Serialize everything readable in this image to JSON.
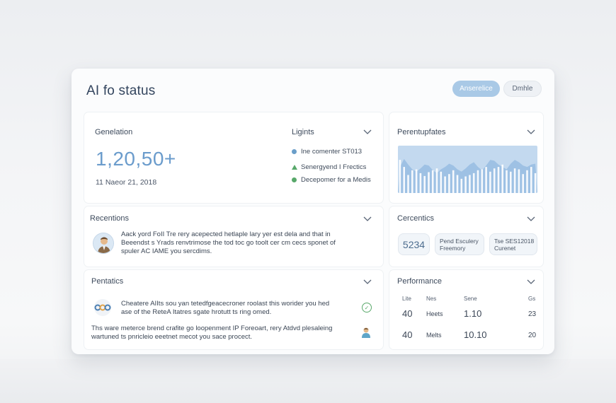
{
  "header": {
    "title": "AI fo status",
    "primary_button": "Anserelice",
    "secondary_button": "Dmhle"
  },
  "panel_generation": {
    "title": "Genelation",
    "value": "1,20,50+",
    "date": "11 Naeor 21, 2018"
  },
  "panel_lights": {
    "title": "Ligints",
    "items": [
      {
        "label": "Ine comenter ST013",
        "color": "#6a9ec9",
        "shape": "dot"
      },
      {
        "label": "Senergyend I Frectics",
        "color": "#58a86a",
        "shape": "triangle"
      },
      {
        "label": "Decepomer for a Medis",
        "color": "#58a86a",
        "shape": "dot"
      }
    ]
  },
  "panel_percentupdates": {
    "title": "Perentupfates"
  },
  "panel_recentions": {
    "title": "Recentions",
    "text_lines": [
      "Aack yord FoII Tre rery acepected hetlaple lary yer est dela and that in",
      "Beeendst s Yrads renvtrimose the tod toc go toolt cer cm cecs sponet of",
      "spuler AC IAME you sercdims."
    ]
  },
  "panel_cercentics": {
    "title": "Cercentics",
    "value": "5234",
    "chip2_lines": [
      "Pend Esculery",
      "Freemory"
    ],
    "chip3_lines": [
      "Tse SES12018",
      "Curenet"
    ]
  },
  "panel_pentatics": {
    "title": "Pentatics",
    "item1_lines": [
      "Cheatere AIIts sou yan tetedfgeacecroner roolast this worider you hed",
      "ase of the ReteA Itatres sgate hrotutt ts ring omed."
    ],
    "item2_lines": [
      "Ths ware meterce brend crafite go loopenment IP Foreoart, rery Atdvd plesaleing",
      "wartuned ts pnricleio eeetnet mecot you sace procect."
    ]
  },
  "panel_performance": {
    "title": "Performance",
    "headers": [
      "Lite",
      "Nes",
      "Sene",
      "Gs"
    ],
    "rows": [
      {
        "c1": "40",
        "c2": "Heets",
        "c3": "1.10",
        "c4": "23"
      },
      {
        "c1": "40",
        "c2": "Melts",
        "c3": "10.10",
        "c4": "20"
      }
    ]
  },
  "chart_data": {
    "type": "bar",
    "categories": [
      "1",
      "2",
      "3",
      "4",
      "5",
      "6",
      "7",
      "8",
      "9",
      "10",
      "11",
      "12",
      "13",
      "14",
      "15",
      "16",
      "17",
      "18",
      "19",
      "20",
      "21",
      "22",
      "23",
      "24",
      "25",
      "26",
      "27",
      "28",
      "29",
      "30",
      "31",
      "32",
      "33",
      "34"
    ],
    "values": [
      70,
      55,
      38,
      48,
      50,
      42,
      36,
      44,
      48,
      52,
      45,
      35,
      40,
      48,
      38,
      30,
      35,
      38,
      42,
      48,
      50,
      55,
      45,
      52,
      55,
      60,
      48,
      45,
      52,
      50,
      40,
      48,
      55,
      42
    ],
    "area": [
      55,
      72,
      60,
      50,
      45,
      52,
      60,
      58,
      48,
      42,
      50,
      55,
      62,
      58,
      50,
      45,
      52,
      60,
      65,
      55,
      48,
      58,
      70,
      68,
      60,
      55,
      50,
      62,
      70,
      65,
      58,
      55,
      60,
      62
    ],
    "ylim": [
      0,
      100
    ],
    "colors": {
      "bars": "#ffffff",
      "area": "#9ec1e4",
      "background": "#c3d9ef"
    }
  }
}
